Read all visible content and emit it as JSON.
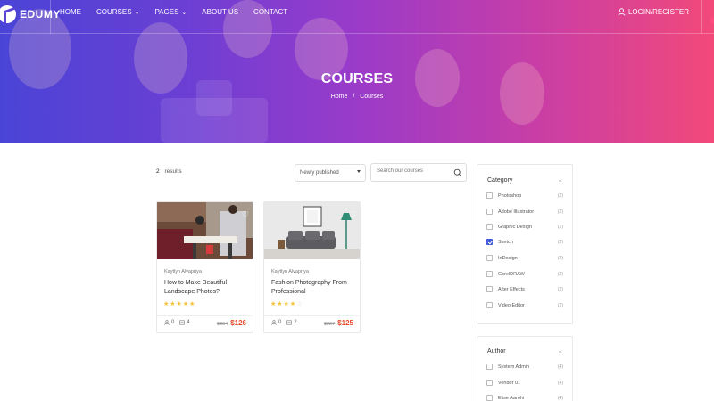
{
  "brand": {
    "name": "EDUMY"
  },
  "nav": {
    "items": [
      {
        "label": "HOME",
        "dropdown": false
      },
      {
        "label": "COURSES",
        "dropdown": true
      },
      {
        "label": "PAGES",
        "dropdown": true
      },
      {
        "label": "ABOUT US",
        "dropdown": false
      },
      {
        "label": "CONTACT",
        "dropdown": false
      }
    ],
    "login_label": "LOGIN/REGISTER"
  },
  "hero": {
    "title": "COURSES",
    "breadcrumb": [
      "Home",
      "Courses"
    ],
    "breadcrumb_separator": "/"
  },
  "toolbar": {
    "result_count": "2",
    "result_label": "results",
    "sort_value": "Newly published",
    "search_placeholder": "Search our courses"
  },
  "courses": [
    {
      "author": "Kaytlyn Alvapriya",
      "title": "How to Make Beautiful Landscape Photos?",
      "rating": 5,
      "stars": "★★★★★",
      "students": "0",
      "lessons": "4",
      "old_price": "$384",
      "price": "$126"
    },
    {
      "author": "Kaytlyn Alvapriya",
      "title": "Fashion Photography From Professional",
      "rating": 4,
      "stars": "★★★★",
      "stars_off": "☆",
      "students": "0",
      "lessons": "2",
      "old_price": "$227",
      "price": "$125"
    }
  ],
  "sidebar": {
    "category": {
      "title": "Category",
      "items": [
        {
          "label": "Photoshop",
          "count": "(2)",
          "checked": false
        },
        {
          "label": "Adobe Illustrator",
          "count": "(2)",
          "checked": false
        },
        {
          "label": "Graphic Design",
          "count": "(2)",
          "checked": false
        },
        {
          "label": "Sketch",
          "count": "(2)",
          "checked": true
        },
        {
          "label": "InDesign",
          "count": "(2)",
          "checked": false
        },
        {
          "label": "CorelDRAW",
          "count": "(2)",
          "checked": false
        },
        {
          "label": "After Effects",
          "count": "(2)",
          "checked": false
        },
        {
          "label": "Video Editor",
          "count": "(2)",
          "checked": false
        }
      ]
    },
    "author": {
      "title": "Author",
      "items": [
        {
          "label": "System Admin",
          "count": "(4)",
          "checked": false
        },
        {
          "label": "Vendor 01",
          "count": "(4)",
          "checked": false
        },
        {
          "label": "Elise Aarohi",
          "count": "(4)",
          "checked": false
        }
      ]
    }
  },
  "colors": {
    "hero_start": "#4a44d6",
    "hero_end": "#f2497a",
    "price": "#e34a2b",
    "star": "#f3c136",
    "checkbox_active": "#3f5bdb"
  }
}
